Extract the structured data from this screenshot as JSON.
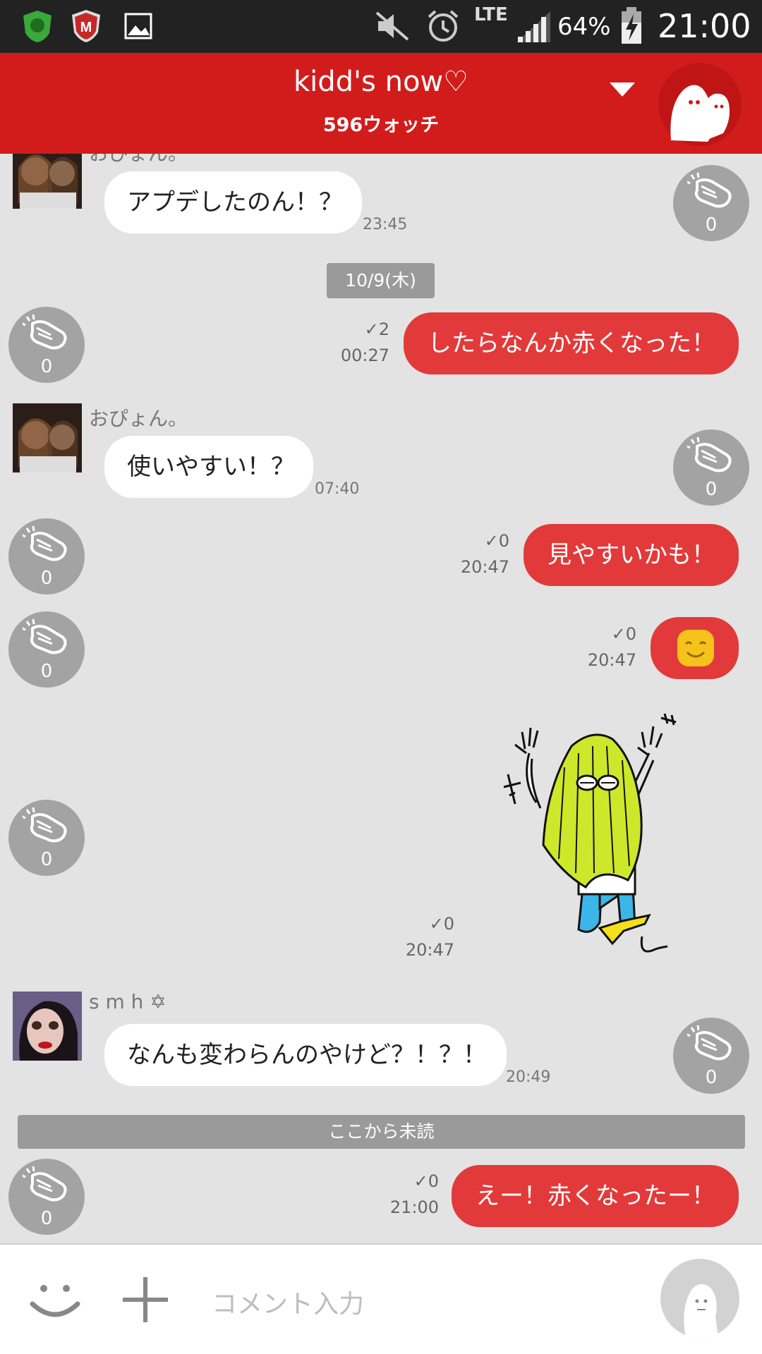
{
  "status_bar": {
    "battery_percent": "64%",
    "network": "LTE",
    "time": "21:00",
    "icons": [
      "shield-app-icon",
      "mcafee-icon",
      "gallery-icon",
      "mute-icon",
      "alarm-icon",
      "signal-icon",
      "battery-charging-icon"
    ]
  },
  "header": {
    "title": "kidd's now♡",
    "subtitle": "596ウォッチ",
    "color": "#d21c1c"
  },
  "chat": {
    "date_divider": "10/9(木)",
    "unread_divider": "ここから未読",
    "messages": [
      {
        "type": "incoming",
        "sender": "おぴょん。",
        "text": "アプデしたのん！？",
        "time": "23:45",
        "claps": "0"
      },
      {
        "type": "outgoing",
        "text": "したらなんか赤くなった！",
        "read": "2",
        "time": "00:27",
        "claps": "0"
      },
      {
        "type": "incoming",
        "sender": "おぴょん。",
        "text": "使いやすい！？",
        "time": "07:40",
        "claps": "0"
      },
      {
        "type": "outgoing",
        "text": "見やすいかも！",
        "read": "0",
        "time": "20:47",
        "claps": "0"
      },
      {
        "type": "outgoing",
        "emoji": "smiley-emoji",
        "read": "0",
        "time": "20:47",
        "claps": "0"
      },
      {
        "type": "outgoing",
        "sticker": "jumping-girl-sticker",
        "read": "0",
        "time": "20:47",
        "claps": "0"
      },
      {
        "type": "incoming",
        "sender": "s m h ✡",
        "text": "なんも変わらんのやけど？！？！",
        "time": "20:49",
        "claps": "0"
      },
      {
        "type": "outgoing",
        "text": "えー！赤くなったー！",
        "read": "0",
        "time": "21:00",
        "claps": "0"
      }
    ]
  },
  "input": {
    "placeholder": "コメント入力"
  }
}
